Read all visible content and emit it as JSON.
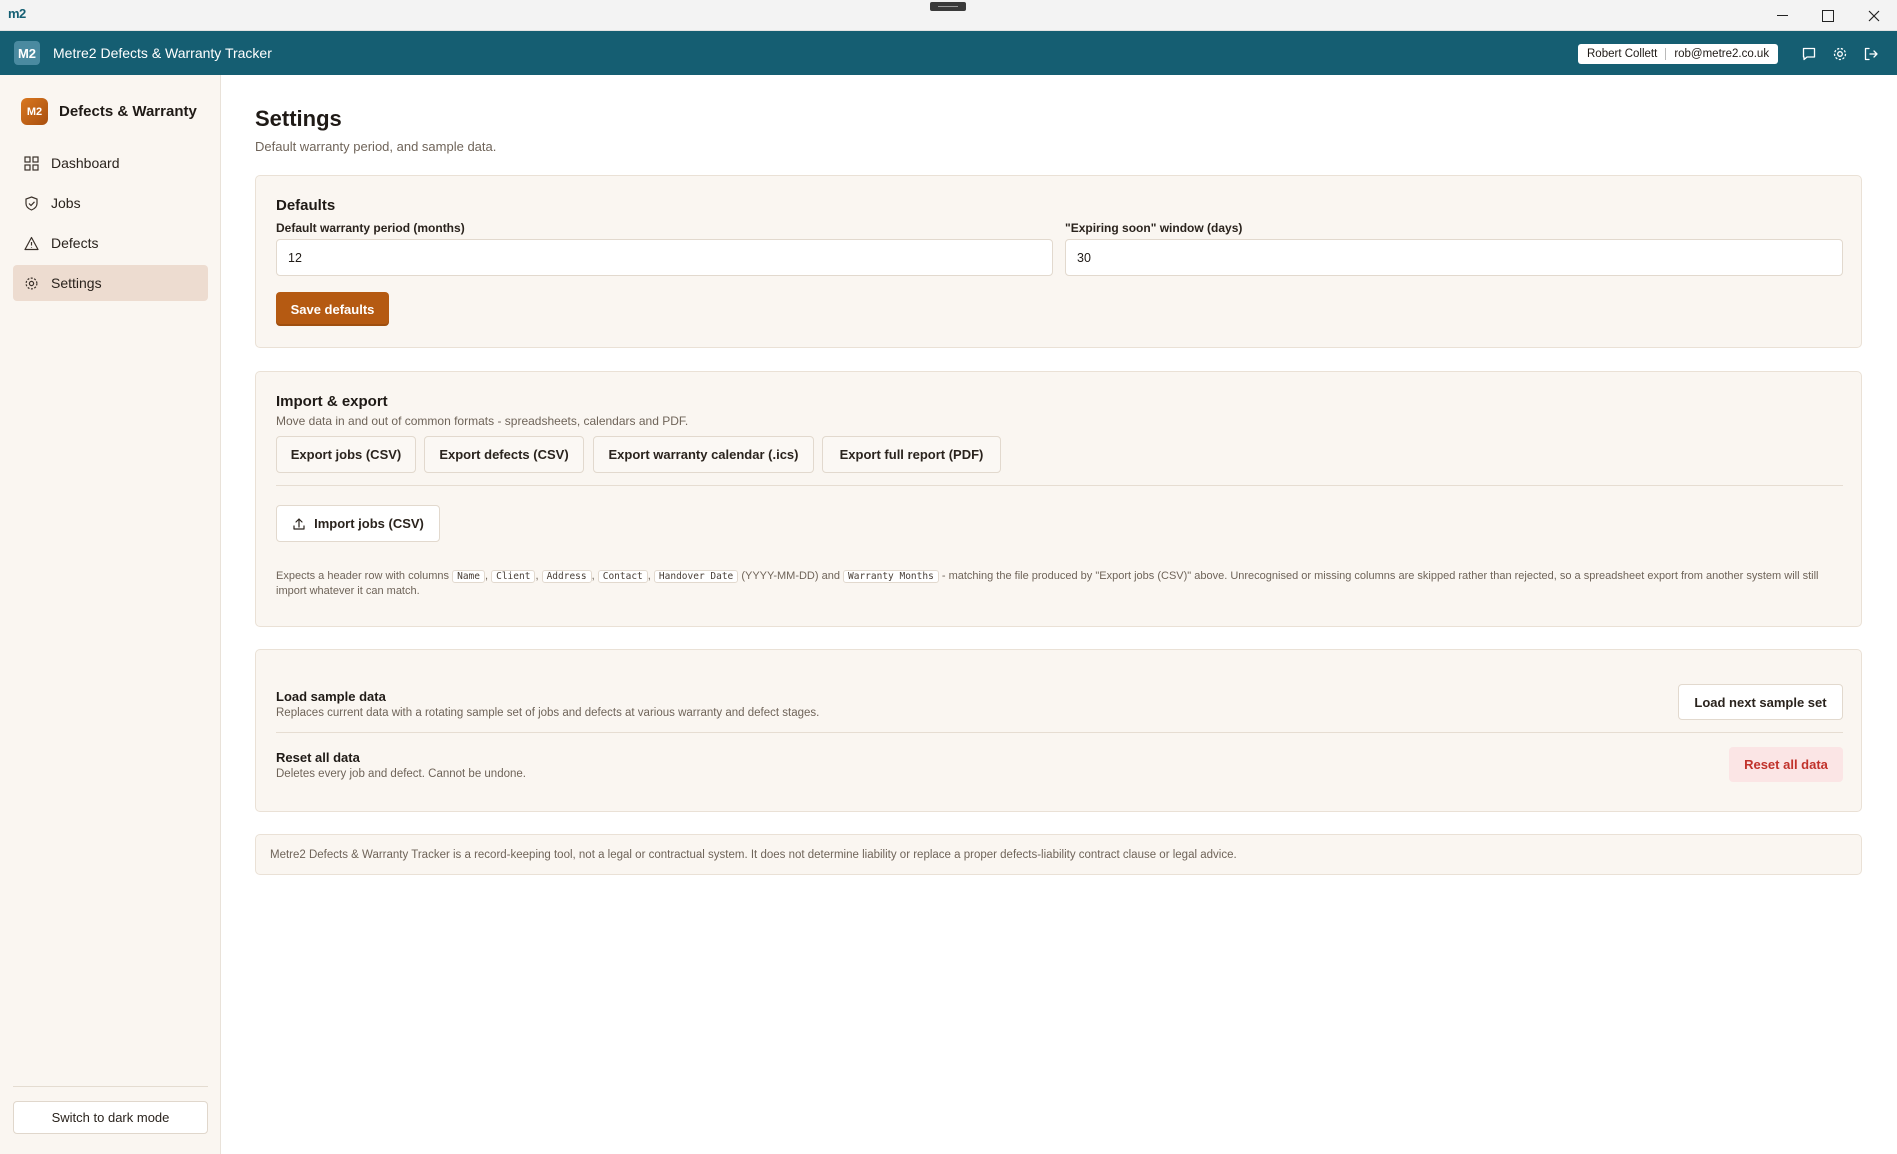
{
  "window": {
    "logo_text": "m2"
  },
  "header": {
    "badge": "M2",
    "title": "Metre2 Defects & Warranty Tracker",
    "user_name": "Robert Collett",
    "user_email": "rob@metre2.co.uk",
    "icons": [
      "chat-icon",
      "gear-icon",
      "logout-icon"
    ]
  },
  "sidebar": {
    "logo": "M2",
    "brand": "Defects & Warranty",
    "items": [
      {
        "label": "Dashboard",
        "icon": "dashboard-icon"
      },
      {
        "label": "Jobs",
        "icon": "shield-icon"
      },
      {
        "label": "Defects",
        "icon": "warning-icon"
      },
      {
        "label": "Settings",
        "icon": "gear-icon",
        "active": true
      }
    ],
    "dark_mode_label": "Switch to dark mode"
  },
  "page": {
    "title": "Settings",
    "subtitle": "Default warranty period, and sample data."
  },
  "defaults": {
    "title": "Defaults",
    "warranty_label": "Default warranty period (months)",
    "warranty_value": "12",
    "expiring_label": "\"Expiring soon\" window (days)",
    "expiring_value": "30",
    "save_label": "Save defaults"
  },
  "import_export": {
    "title": "Import & export",
    "subtitle": "Move data in and out of common formats - spreadsheets, calendars and PDF.",
    "export_jobs": "Export jobs (CSV)",
    "export_defects": "Export defects (CSV)",
    "export_calendar": "Export warranty calendar (.ics)",
    "export_report": "Export full report (PDF)",
    "import_jobs": "Import jobs (CSV)",
    "help_prefix": "Expects a header row with columns",
    "columns": [
      "Name",
      "Client",
      "Address",
      "Contact",
      "Handover Date",
      "Warranty Months"
    ],
    "date_format": "(YYYY-MM-DD) and",
    "help_suffix": "- matching the file produced by \"Export jobs (CSV)\" above. Unrecognised or missing columns are skipped rather than rejected, so a spreadsheet export from another system will still import whatever it can match."
  },
  "data": {
    "sample_title": "Load sample data",
    "sample_desc": "Replaces current data with a rotating sample set of jobs and defects at various warranty and defect stages.",
    "sample_button": "Load next sample set",
    "reset_title": "Reset all data",
    "reset_desc": "Deletes every job and defect. Cannot be undone.",
    "reset_button": "Reset all data"
  },
  "disclaimer": "Metre2 Defects & Warranty Tracker is a record-keeping tool, not a legal or contractual system. It does not determine liability or replace a proper defects-liability contract clause or legal advice.",
  "colors": {
    "header": "#155e72",
    "accent": "#b55a12",
    "danger": "#c1322b",
    "card": "#faf6f1"
  }
}
